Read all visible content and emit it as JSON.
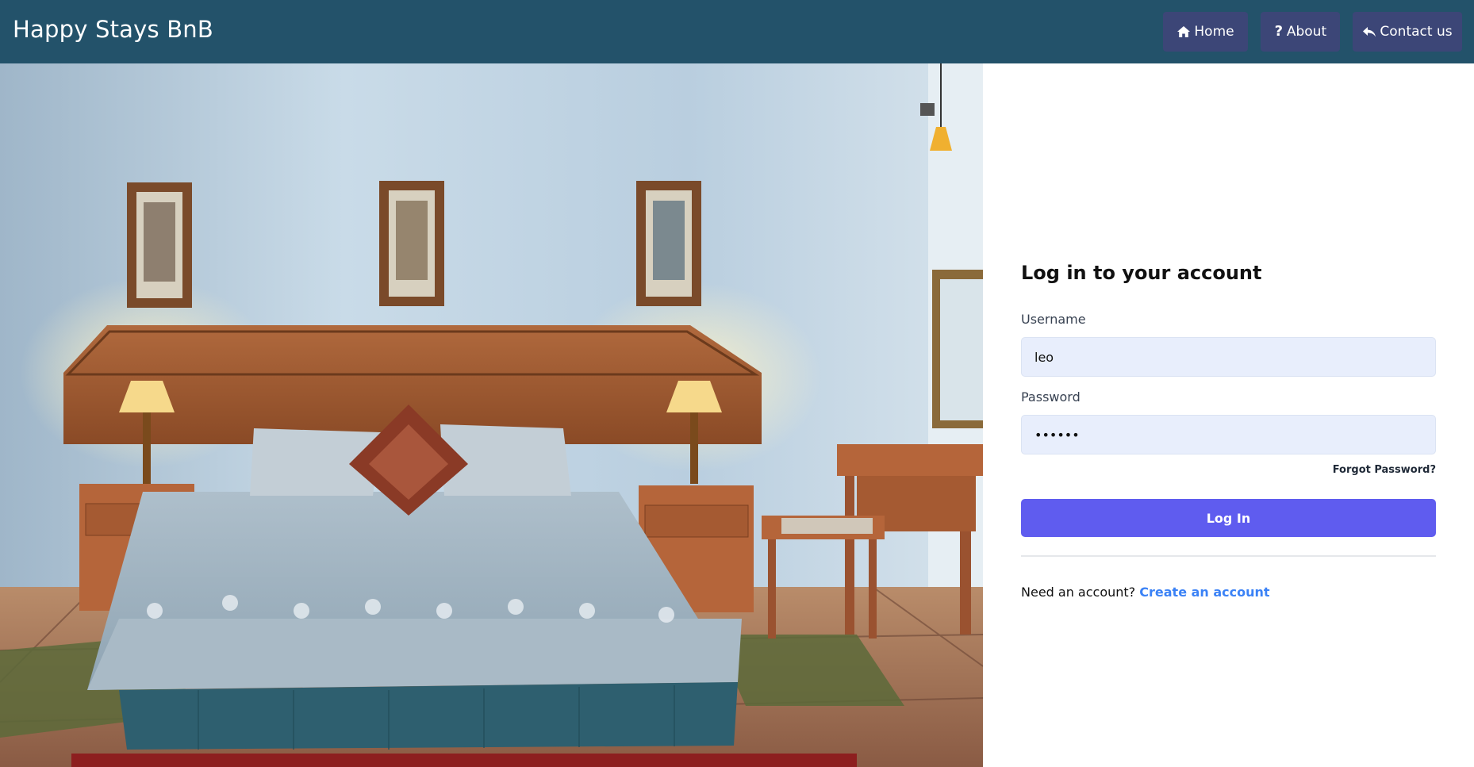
{
  "app": {
    "brand": "Happy Stays BnB"
  },
  "nav": {
    "home_label": "Home",
    "home_icon": "home-icon",
    "about_label": "About",
    "about_icon": "question-icon",
    "contact_label": "Contact us",
    "contact_icon": "reply-icon"
  },
  "login": {
    "title": "Log in to your account",
    "username_label": "Username",
    "username_value": "leo",
    "password_label": "Password",
    "password_value": "••••••",
    "forgot_label": "Forgot Password?",
    "submit_label": "Log In",
    "signup_prompt": "Need an account?",
    "signup_link": "Create an account"
  },
  "colors": {
    "navbar": "#23526a",
    "nav_button": "#3c4677",
    "primary_button": "#5f5cef",
    "link": "#3b82f6",
    "input_bg": "#e8eefc"
  }
}
